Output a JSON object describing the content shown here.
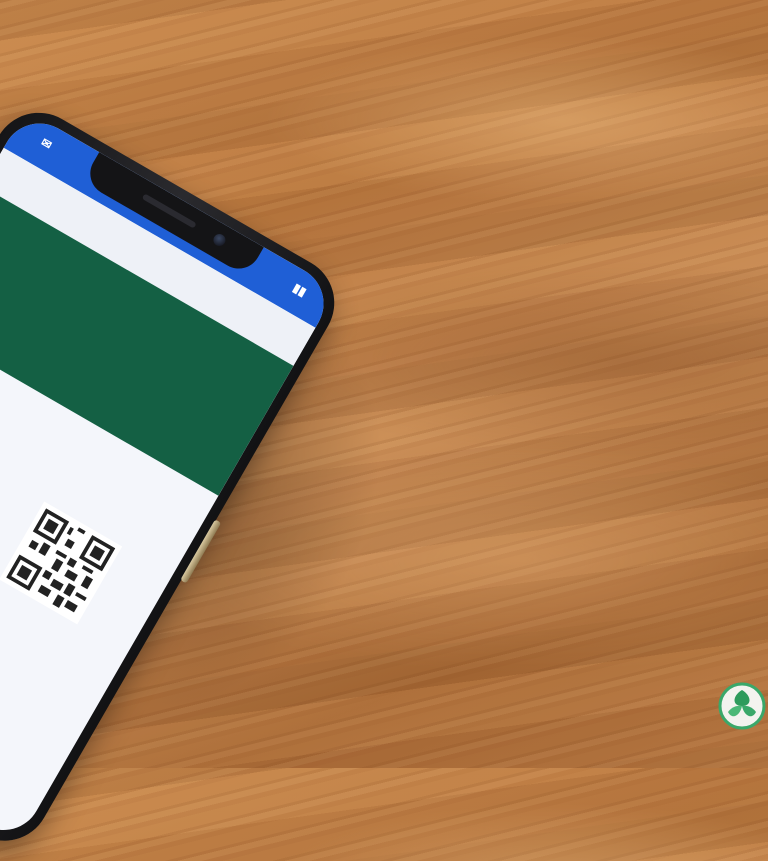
{
  "scene": {
    "statusbar": {
      "left_icon": "mail-icon",
      "right_icon": "battery-icon"
    },
    "ticket": {
      "header_color": "#146044",
      "statusbar_color": "#1f5fd6",
      "button_color": "#2a8ff0"
    },
    "corner_logo": {
      "icon": "leaf-logo-icon"
    }
  }
}
